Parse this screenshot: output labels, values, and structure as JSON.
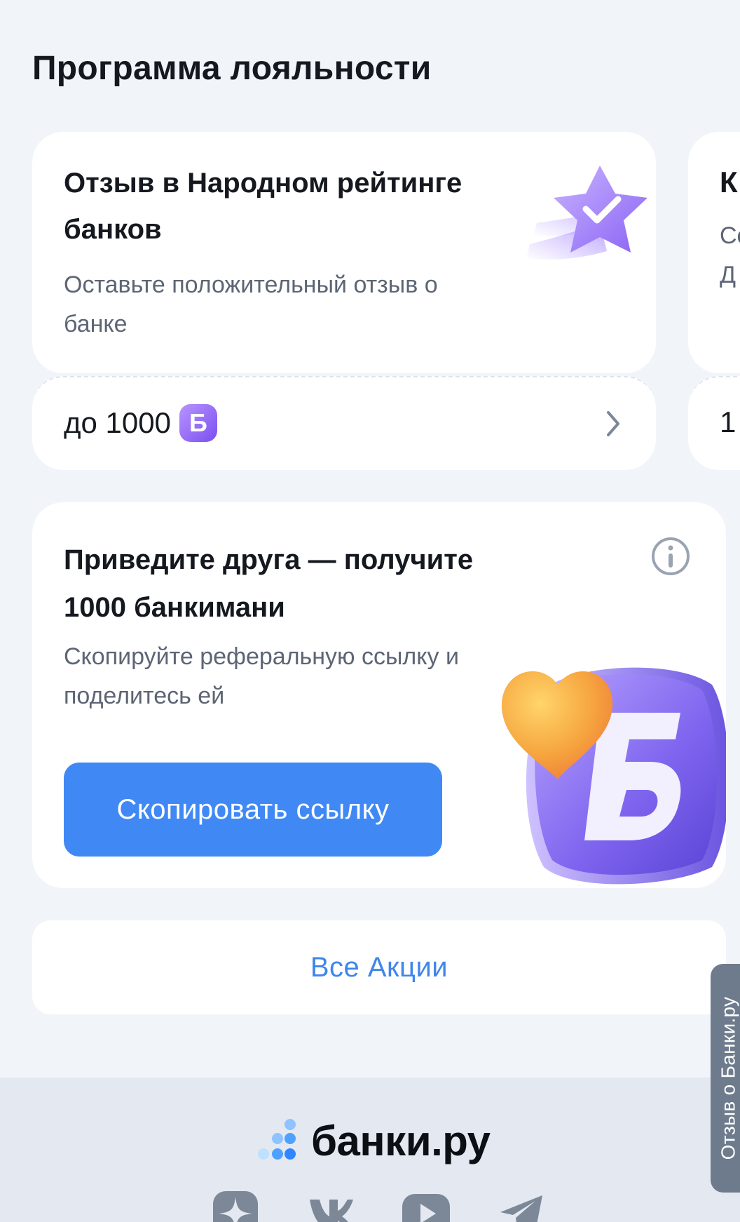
{
  "section": {
    "title": "Программа лояльности"
  },
  "loyalty_cards": [
    {
      "title": "Отзыв в Народном рейтинге банков",
      "subtitle": "Оставьте положительный отзыв о банке",
      "reward_prefix": "до 1000",
      "reward_currency_badge": "Б"
    },
    {
      "title_visible": "К",
      "subtitle_visible": "Со\nД",
      "reward_visible": "1"
    }
  ],
  "referral": {
    "title": "Приведите друга — получите 1000 банкимани",
    "subtitle": "Скопируйте реферальную ссылку и поделитесь ей",
    "button_label": "Скопировать ссылку",
    "art_letter": "Б"
  },
  "all_promotions_label": "Все Акции",
  "footer": {
    "logo_text": "банки.ру",
    "socials": [
      "dzen-icon",
      "vk-icon",
      "youtube-icon",
      "telegram-icon"
    ]
  },
  "feedback_tab_label": "Отзыв о Банки.ру",
  "colors": {
    "background": "#f1f4f9",
    "primary_button": "#4089f5",
    "link": "#3f86ec",
    "badge_purple": "#7a4ff0",
    "footer_bg": "#e4e9f1",
    "feedback_tab": "#6e7b8d"
  }
}
